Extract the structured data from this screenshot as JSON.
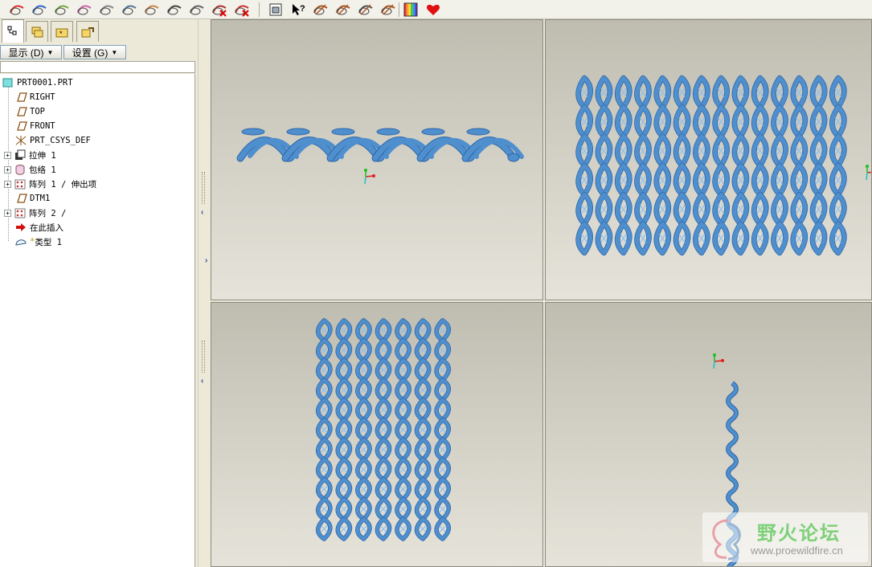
{
  "toolbar": {
    "icons": [
      "datum-plane-icon",
      "datum-axis-icon",
      "datum-curve-icon",
      "shading-icon",
      "saved-view-icon",
      "spin-center-icon",
      "orient-icon",
      "dimension-icon",
      "measure-icon",
      "hide-icon",
      "delete-icon",
      "view-manager-icon",
      "what-is-this-icon",
      "plane-display-icon",
      "axis-display-icon",
      "point-display-icon",
      "csys-display-icon",
      "appearance-icon",
      "favorite-heart-icon"
    ]
  },
  "nav_tabs": [
    "model-tree-tab",
    "folder-browser-tab",
    "favorites-tab",
    "connections-tab"
  ],
  "menus": {
    "show_label": "显示 (D)",
    "settings_label": "设置 (G)"
  },
  "tree": {
    "items": [
      {
        "label": "PRT0001.PRT",
        "icon": "part-icon",
        "expandable": false
      },
      {
        "label": "RIGHT",
        "icon": "datum-plane-icon",
        "expandable": false
      },
      {
        "label": "TOP",
        "icon": "datum-plane-icon",
        "expandable": false
      },
      {
        "label": "FRONT",
        "icon": "datum-plane-icon",
        "expandable": false
      },
      {
        "label": "PRT_CSYS_DEF",
        "icon": "csys-icon",
        "expandable": false
      },
      {
        "label": "拉伸 1",
        "icon": "extrude-icon",
        "expandable": true
      },
      {
        "label": "包络 1",
        "icon": "wrap-icon",
        "expandable": true
      },
      {
        "label": "阵列 1 / 伸出项",
        "icon": "pattern-icon",
        "expandable": true
      },
      {
        "label": "DTM1",
        "icon": "datum-plane-icon",
        "expandable": false
      },
      {
        "label": "阵列 2 /",
        "icon": "pattern-icon",
        "expandable": true
      },
      {
        "label": "在此插入",
        "icon": "insert-here-icon",
        "expandable": false
      },
      {
        "label": "类型 1",
        "icon": "feature-type-icon",
        "expandable": false
      }
    ]
  },
  "viewports": [
    {
      "name": "top-view",
      "view": "top"
    },
    {
      "name": "iso-front-view",
      "view": "front"
    },
    {
      "name": "right-view",
      "view": "right"
    },
    {
      "name": "side-view",
      "view": "side"
    }
  ],
  "watermark": {
    "title": "野火论坛",
    "url": "www.proewildfire.cn"
  },
  "colors": {
    "mesh": "#4f8fce",
    "mesh_dark": "#2e66a8",
    "bg_top": "#bfbcb0",
    "bg_bottom": "#e6e4da"
  }
}
